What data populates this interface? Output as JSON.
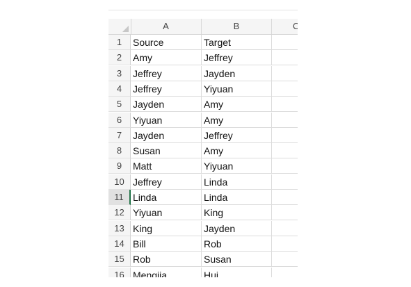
{
  "columns": [
    "A",
    "B",
    "C"
  ],
  "rows": [
    {
      "num": "1",
      "a": "Source",
      "b": "Target"
    },
    {
      "num": "2",
      "a": "Amy",
      "b": "Jeffrey"
    },
    {
      "num": "3",
      "a": "Jeffrey",
      "b": "Jayden"
    },
    {
      "num": "4",
      "a": "Jeffrey",
      "b": "Yiyuan"
    },
    {
      "num": "5",
      "a": "Jayden",
      "b": "Amy"
    },
    {
      "num": "6",
      "a": "Yiyuan",
      "b": "Amy"
    },
    {
      "num": "7",
      "a": "Jayden",
      "b": "Jeffrey"
    },
    {
      "num": "8",
      "a": "Susan",
      "b": "Amy"
    },
    {
      "num": "9",
      "a": "Matt",
      "b": "Yiyuan"
    },
    {
      "num": "10",
      "a": "Jeffrey",
      "b": "Linda"
    },
    {
      "num": "11",
      "a": "Linda",
      "b": "Linda"
    },
    {
      "num": "12",
      "a": "Yiyuan",
      "b": "King"
    },
    {
      "num": "13",
      "a": "King",
      "b": "Jayden"
    },
    {
      "num": "14",
      "a": "Bill",
      "b": "Rob"
    },
    {
      "num": "15",
      "a": "Rob",
      "b": "Susan"
    },
    {
      "num": "16",
      "a": "Mengjia",
      "b": "Hui"
    }
  ],
  "active_row": "11",
  "colors": {
    "header_bg": "#f5f5f5",
    "active_accent": "#1e7145",
    "grid": "#dcdcdc"
  }
}
